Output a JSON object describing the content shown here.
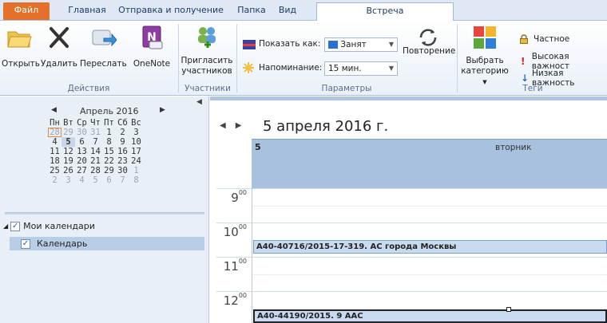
{
  "tabs": {
    "file": "Файл",
    "home": "Главная",
    "send_receive": "Отправка и получение",
    "folder": "Папка",
    "view": "Вид",
    "meeting": "Встреча"
  },
  "ribbon": {
    "actions": {
      "open": "Открыть",
      "delete": "Удалить",
      "forward": "Переслать",
      "onenote": "OneNote",
      "label": "Действия"
    },
    "participants": {
      "invite_line1": "Пригласить",
      "invite_line2": "участников",
      "label": "Участники"
    },
    "params": {
      "show_as_label": "Показать как:",
      "show_as_value": "Занят",
      "reminder_label": "Напоминание:",
      "reminder_value": "15 мин.",
      "recurrence": "Повторение",
      "label": "Параметры"
    },
    "tags": {
      "categorize_line1": "Выбрать",
      "categorize_line2": "категорию",
      "private": "Частное",
      "high_importance": "Высокая важност",
      "low_importance": "Низкая важность",
      "label": "Теги"
    }
  },
  "mini_calendar": {
    "month": "Апрель 2016",
    "weekdays": [
      "Пн",
      "Вт",
      "Ср",
      "Чт",
      "Пт",
      "Сб",
      "Вс"
    ],
    "weeks": [
      [
        "28",
        "29",
        "30",
        "31",
        "1",
        "2",
        "3"
      ],
      [
        "4",
        "5",
        "6",
        "7",
        "8",
        "9",
        "10"
      ],
      [
        "11",
        "12",
        "13",
        "14",
        "15",
        "16",
        "17"
      ],
      [
        "18",
        "19",
        "20",
        "21",
        "22",
        "23",
        "24"
      ],
      [
        "25",
        "26",
        "27",
        "28",
        "29",
        "30",
        "1"
      ],
      [
        "2",
        "3",
        "4",
        "5",
        "6",
        "7",
        "8"
      ]
    ]
  },
  "my_calendars": {
    "group": "Мои календари",
    "item": "Календарь"
  },
  "day_view": {
    "date_title": "5 апреля 2016 г.",
    "day_number": "5",
    "day_name": "вторник",
    "hours": [
      "9",
      "10",
      "11",
      "12"
    ],
    "minutes": "00",
    "events": [
      "А40-40716/2015-17-319. АС города Москвы",
      "А40-44190/2015. 9 ААС"
    ]
  },
  "colors": {
    "file_tab": "#e5702a",
    "day_header": "#a7c1df",
    "event_fill": "#c8daf0"
  }
}
